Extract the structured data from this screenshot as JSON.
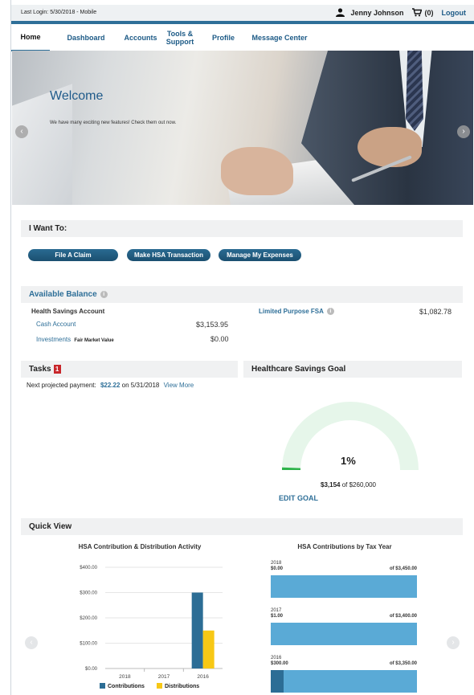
{
  "topbar": {
    "last_login": "Last Login: 5/30/2018 - Mobile",
    "user_name": "Jenny Johnson",
    "cart_count": "(0)",
    "logout": "Logout"
  },
  "nav": {
    "items": [
      "Home",
      "Dashboard",
      "Accounts",
      "Tools &\nSupport",
      "Profile",
      "Message Center"
    ]
  },
  "hero": {
    "title": "Welcome",
    "subtitle": "We have many exciting new features! Check them out now."
  },
  "i_want_to": {
    "title": "I Want To:",
    "buttons": [
      "File A Claim",
      "Make HSA Transaction",
      "Manage My Expenses"
    ]
  },
  "balance": {
    "title": "Available Balance",
    "hsa_label": "Health Savings Account",
    "cash_label": "Cash Account",
    "cash_value": "$3,153.95",
    "investments_label": "Investments",
    "fmv_label": "Fair Market Value",
    "investments_value": "$0.00",
    "lpfsa_label": "Limited Purpose FSA",
    "lpfsa_value": "$1,082.78"
  },
  "tasks": {
    "title": "Tasks",
    "badge": "1",
    "next_label": "Next projected payment:",
    "amount": "$22.22",
    "on_date": "on 5/31/2018",
    "view_more": "View More"
  },
  "goal": {
    "title": "Healthcare Savings Goal",
    "percent_label": "1%",
    "progress": 0.012,
    "saved": "$3,154",
    "of_text": "of $260,000",
    "edit": "EDIT GOAL"
  },
  "quick_view": {
    "title": "Quick View"
  },
  "colors": {
    "accent": "#2e6f98",
    "contribution": "#2c6d95",
    "distribution": "#f7c815",
    "gauge_track": "#e6f6ea",
    "gauge_fill": "#2db34a",
    "bar_fill": "#5aaad6"
  },
  "chart_data": [
    {
      "type": "bar",
      "title": "HSA Contribution & Distribution Activity",
      "categories": [
        "2018",
        "2017",
        "2016"
      ],
      "ylim": [
        0,
        400
      ],
      "yticks": [
        "$0.00",
        "$100.00",
        "$200.00",
        "$300.00",
        "$400.00"
      ],
      "series": [
        {
          "name": "Contributions",
          "values": [
            0,
            0,
            300
          ]
        },
        {
          "name": "Distributions",
          "values": [
            0,
            0,
            150
          ]
        }
      ],
      "legend": "bottom"
    },
    {
      "type": "bar",
      "title": "HSA Contributions by Tax Year",
      "orientation": "horizontal",
      "rows": [
        {
          "year": "2018",
          "amount_label": "$0.00",
          "limit_label": "of $3,450.00",
          "amount": 0,
          "limit": 3450
        },
        {
          "year": "2017",
          "amount_label": "$1.00",
          "limit_label": "of $3,400.00",
          "amount": 1,
          "limit": 3400
        },
        {
          "year": "2016",
          "amount_label": "$300.00",
          "limit_label": "of $3,350.00",
          "amount": 300,
          "limit": 3350
        }
      ]
    }
  ]
}
